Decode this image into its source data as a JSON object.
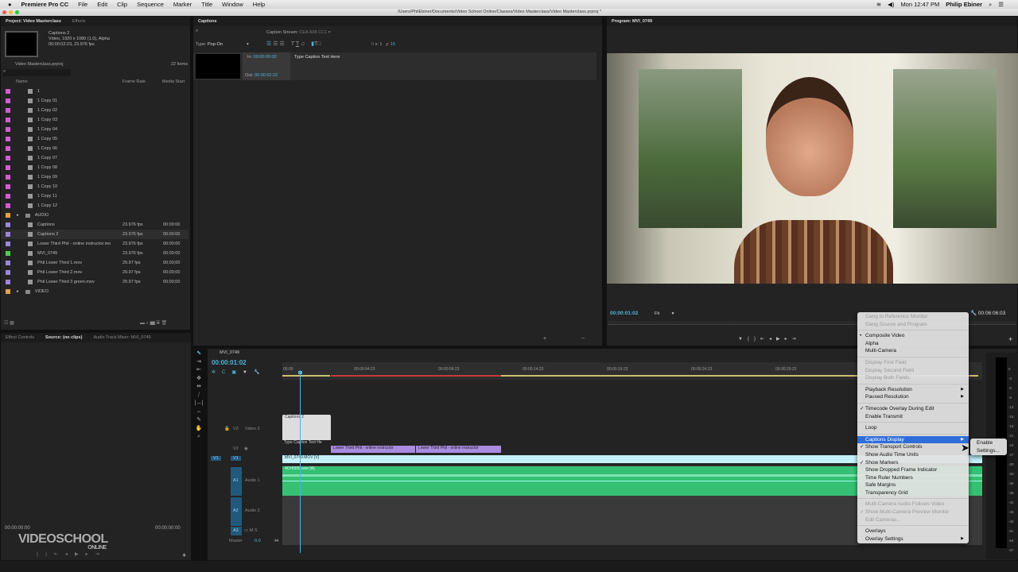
{
  "menubar": {
    "app": "Premiere Pro CC",
    "items": [
      "File",
      "Edit",
      "Clip",
      "Sequence",
      "Marker",
      "Title",
      "Window",
      "Help"
    ],
    "clock": "Mon 12:47 PM",
    "user": "Philip Ebiner"
  },
  "titlebar": {
    "path": "/Users/PhilEbiner/Documents/Video School Online/Classes/Video Masterclass/Video Masterclass.prproj *"
  },
  "project": {
    "tabs": [
      "Project: Video Masterclass",
      "Effects"
    ],
    "preview_name": "Captions 2",
    "preview_info1": "Video, 1920 x 1080 (1.0), Alpha",
    "preview_info2": "00:00:02:23, 23.976 fps",
    "project_file": "Video Masterclass.prproj",
    "item_count": "22 Items",
    "columns": [
      "Name",
      "Frame Rate",
      "Media Start"
    ],
    "items": [
      {
        "name": "1",
        "rate": "",
        "start": "",
        "color": "#d65ad6"
      },
      {
        "name": "1 Copy 01",
        "rate": "",
        "start": "",
        "color": "#d65ad6"
      },
      {
        "name": "1 Copy 02",
        "rate": "",
        "start": "",
        "color": "#d65ad6"
      },
      {
        "name": "1 Copy 03",
        "rate": "",
        "start": "",
        "color": "#d65ad6"
      },
      {
        "name": "1 Copy 04",
        "rate": "",
        "start": "",
        "color": "#d65ad6"
      },
      {
        "name": "1 Copy 05",
        "rate": "",
        "start": "",
        "color": "#d65ad6"
      },
      {
        "name": "1 Copy 06",
        "rate": "",
        "start": "",
        "color": "#d65ad6"
      },
      {
        "name": "1 Copy 07",
        "rate": "",
        "start": "",
        "color": "#d65ad6"
      },
      {
        "name": "1 Copy 08",
        "rate": "",
        "start": "",
        "color": "#d65ad6"
      },
      {
        "name": "1 Copy 09",
        "rate": "",
        "start": "",
        "color": "#d65ad6"
      },
      {
        "name": "1 Copy 10",
        "rate": "",
        "start": "",
        "color": "#d65ad6"
      },
      {
        "name": "1 Copy 11",
        "rate": "",
        "start": "",
        "color": "#d65ad6"
      },
      {
        "name": "1 Copy 12",
        "rate": "",
        "start": "",
        "color": "#d65ad6"
      },
      {
        "name": "AUDIO",
        "rate": "",
        "start": "",
        "color": "#e8a040"
      },
      {
        "name": "Captions",
        "rate": "23.976 fps",
        "start": "00:00:00",
        "color": "#9b85e0"
      },
      {
        "name": "Captions 2",
        "rate": "23.976 fps",
        "start": "00:00:00",
        "color": "#9b85e0"
      },
      {
        "name": "Lower Third Phil - online instructor.mo",
        "rate": "23.976 fps",
        "start": "00:00:00",
        "color": "#9b85e0"
      },
      {
        "name": "MVI_0749",
        "rate": "23.976 fps",
        "start": "00:00:00",
        "color": "#4cd04c"
      },
      {
        "name": "Phil Lower Third 1.mov",
        "rate": "29.97 fps",
        "start": "00;00;00",
        "color": "#9b85e0"
      },
      {
        "name": "Phil Lower Third 2.mov",
        "rate": "29.97 fps",
        "start": "00;00;00",
        "color": "#9b85e0"
      },
      {
        "name": "Phil Lower Third 3 green.mov",
        "rate": "29.97 fps",
        "start": "00;00;00",
        "color": "#9b85e0"
      },
      {
        "name": "VIDEO",
        "rate": "",
        "start": "",
        "color": "#e8a040"
      }
    ]
  },
  "captions": {
    "tab": "Captions",
    "stream_label": "Caption Stream:",
    "stream_value": "CEA-608 CC1",
    "type_label": "Type:",
    "type_value": "Pop-On",
    "x_label": "x:",
    "x_value": "1",
    "y_label": "y:",
    "y_value": "15",
    "in_label": "In:",
    "in_value": "00:00:00:00",
    "out_label": "Out:",
    "out_value": "00:00:02:23",
    "caption_text": "Type Caption Text Here"
  },
  "program": {
    "tab": "Program: MVI_0749",
    "timecode": "00:00:01:02",
    "fit": "Fit",
    "duration": "00:06:06:03"
  },
  "source": {
    "tabs": [
      "Effect Controls",
      "Source: (no clips)",
      "Audio Track Mixer: MVI_0749"
    ],
    "tc_left": "00:00:00:00",
    "tc_right": "00:00:00:00",
    "logo": "VIDEOSCHOOL ONLINE"
  },
  "timeline": {
    "tab": "MVI_0749",
    "timecode": "00:00:01:02",
    "ruler": [
      "00:00",
      "00:00:04:23",
      "00:00:09:23",
      "00:00:14:23",
      "00:00:19:23",
      "00:00:24:23",
      "00:00:29:23"
    ],
    "tracks": {
      "v3": "V3",
      "v3_name": "Video 3",
      "v2": "V2",
      "v1": "V1",
      "a1": "A1",
      "a1_name": "Audio 1",
      "a2": "A2",
      "a2_name": "Audio 2",
      "a3": "A3",
      "master": "Master",
      "master_val": "0.0"
    },
    "clips": {
      "captions": "Captions 2",
      "caption_text": "Type Caption Text He",
      "lower1": "Lower Third Phil - online instructor",
      "lower2": "Lower Third Phil - online instructor",
      "video": "MVI_0749.MOV [V]",
      "audio": "4CH005I.wav [A]"
    }
  },
  "meter": [
    "0",
    "-3",
    "-6",
    "-9",
    "-12",
    "-15",
    "-18",
    "-21",
    "-24",
    "-27",
    "-30",
    "-33",
    "-36",
    "-39",
    "-42",
    "-45",
    "-48",
    "-51",
    "-54",
    "-57"
  ],
  "context_menu": {
    "groups": [
      [
        {
          "label": "Gang to Reference Monitor",
          "disabled": true
        },
        {
          "label": "Gang Source and Program",
          "disabled": true
        }
      ],
      [
        {
          "label": "Composite Video",
          "mark": "•"
        },
        {
          "label": "Alpha"
        },
        {
          "label": "Multi-Camera"
        }
      ],
      [
        {
          "label": "Display First Field",
          "disabled": true
        },
        {
          "label": "Display Second Field",
          "disabled": true
        },
        {
          "label": "Display Both Fields",
          "disabled": true
        }
      ],
      [
        {
          "label": "Playback Resolution",
          "sub": true
        },
        {
          "label": "Paused Resolution",
          "sub": true
        }
      ],
      [
        {
          "label": "Timecode Overlay During Edit",
          "mark": "✓"
        },
        {
          "label": "Enable Transmit"
        }
      ],
      [
        {
          "label": "Loop"
        }
      ],
      [
        {
          "label": "Captions Display",
          "sub": true,
          "selected": true
        },
        {
          "label": "Show Transport Controls",
          "mark": "✓"
        },
        {
          "label": "Show Audio Time Units"
        },
        {
          "label": "Show Markers",
          "mark": "✓"
        },
        {
          "label": "Show Dropped Frame Indicator"
        },
        {
          "label": "Time Ruler Numbers"
        },
        {
          "label": "Safe Margins"
        },
        {
          "label": "Transparency Grid"
        }
      ],
      [
        {
          "label": "Multi-Camera Audio Follows Video",
          "disabled": true
        },
        {
          "label": "Show Multi-Camera Preview Monitor",
          "disabled": true,
          "mark": "✓"
        },
        {
          "label": "Edit Cameras...",
          "disabled": true
        }
      ],
      [
        {
          "label": "Overlays"
        },
        {
          "label": "Overlay Settings",
          "sub": true
        }
      ]
    ],
    "submenu": [
      "Enable",
      "Settings..."
    ]
  }
}
